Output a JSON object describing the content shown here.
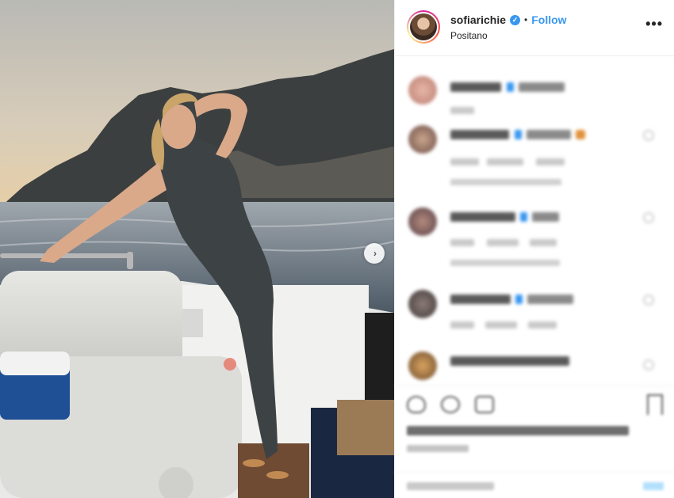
{
  "post": {
    "username": "sofiarichie",
    "verified_symbol": "✓",
    "separator": "•",
    "follow_label": "Follow",
    "location": "Positano",
    "more_label": "•••",
    "next_arrow": "›"
  },
  "icons": {
    "verified": "verified-badge-icon",
    "more": "more-options-icon",
    "next": "chevron-right-icon",
    "like": "heart-icon",
    "comment": "comment-icon",
    "share": "share-icon",
    "save": "bookmark-icon"
  },
  "colors": {
    "accent": "#3897f0",
    "text": "#262626",
    "border": "#efefef"
  }
}
